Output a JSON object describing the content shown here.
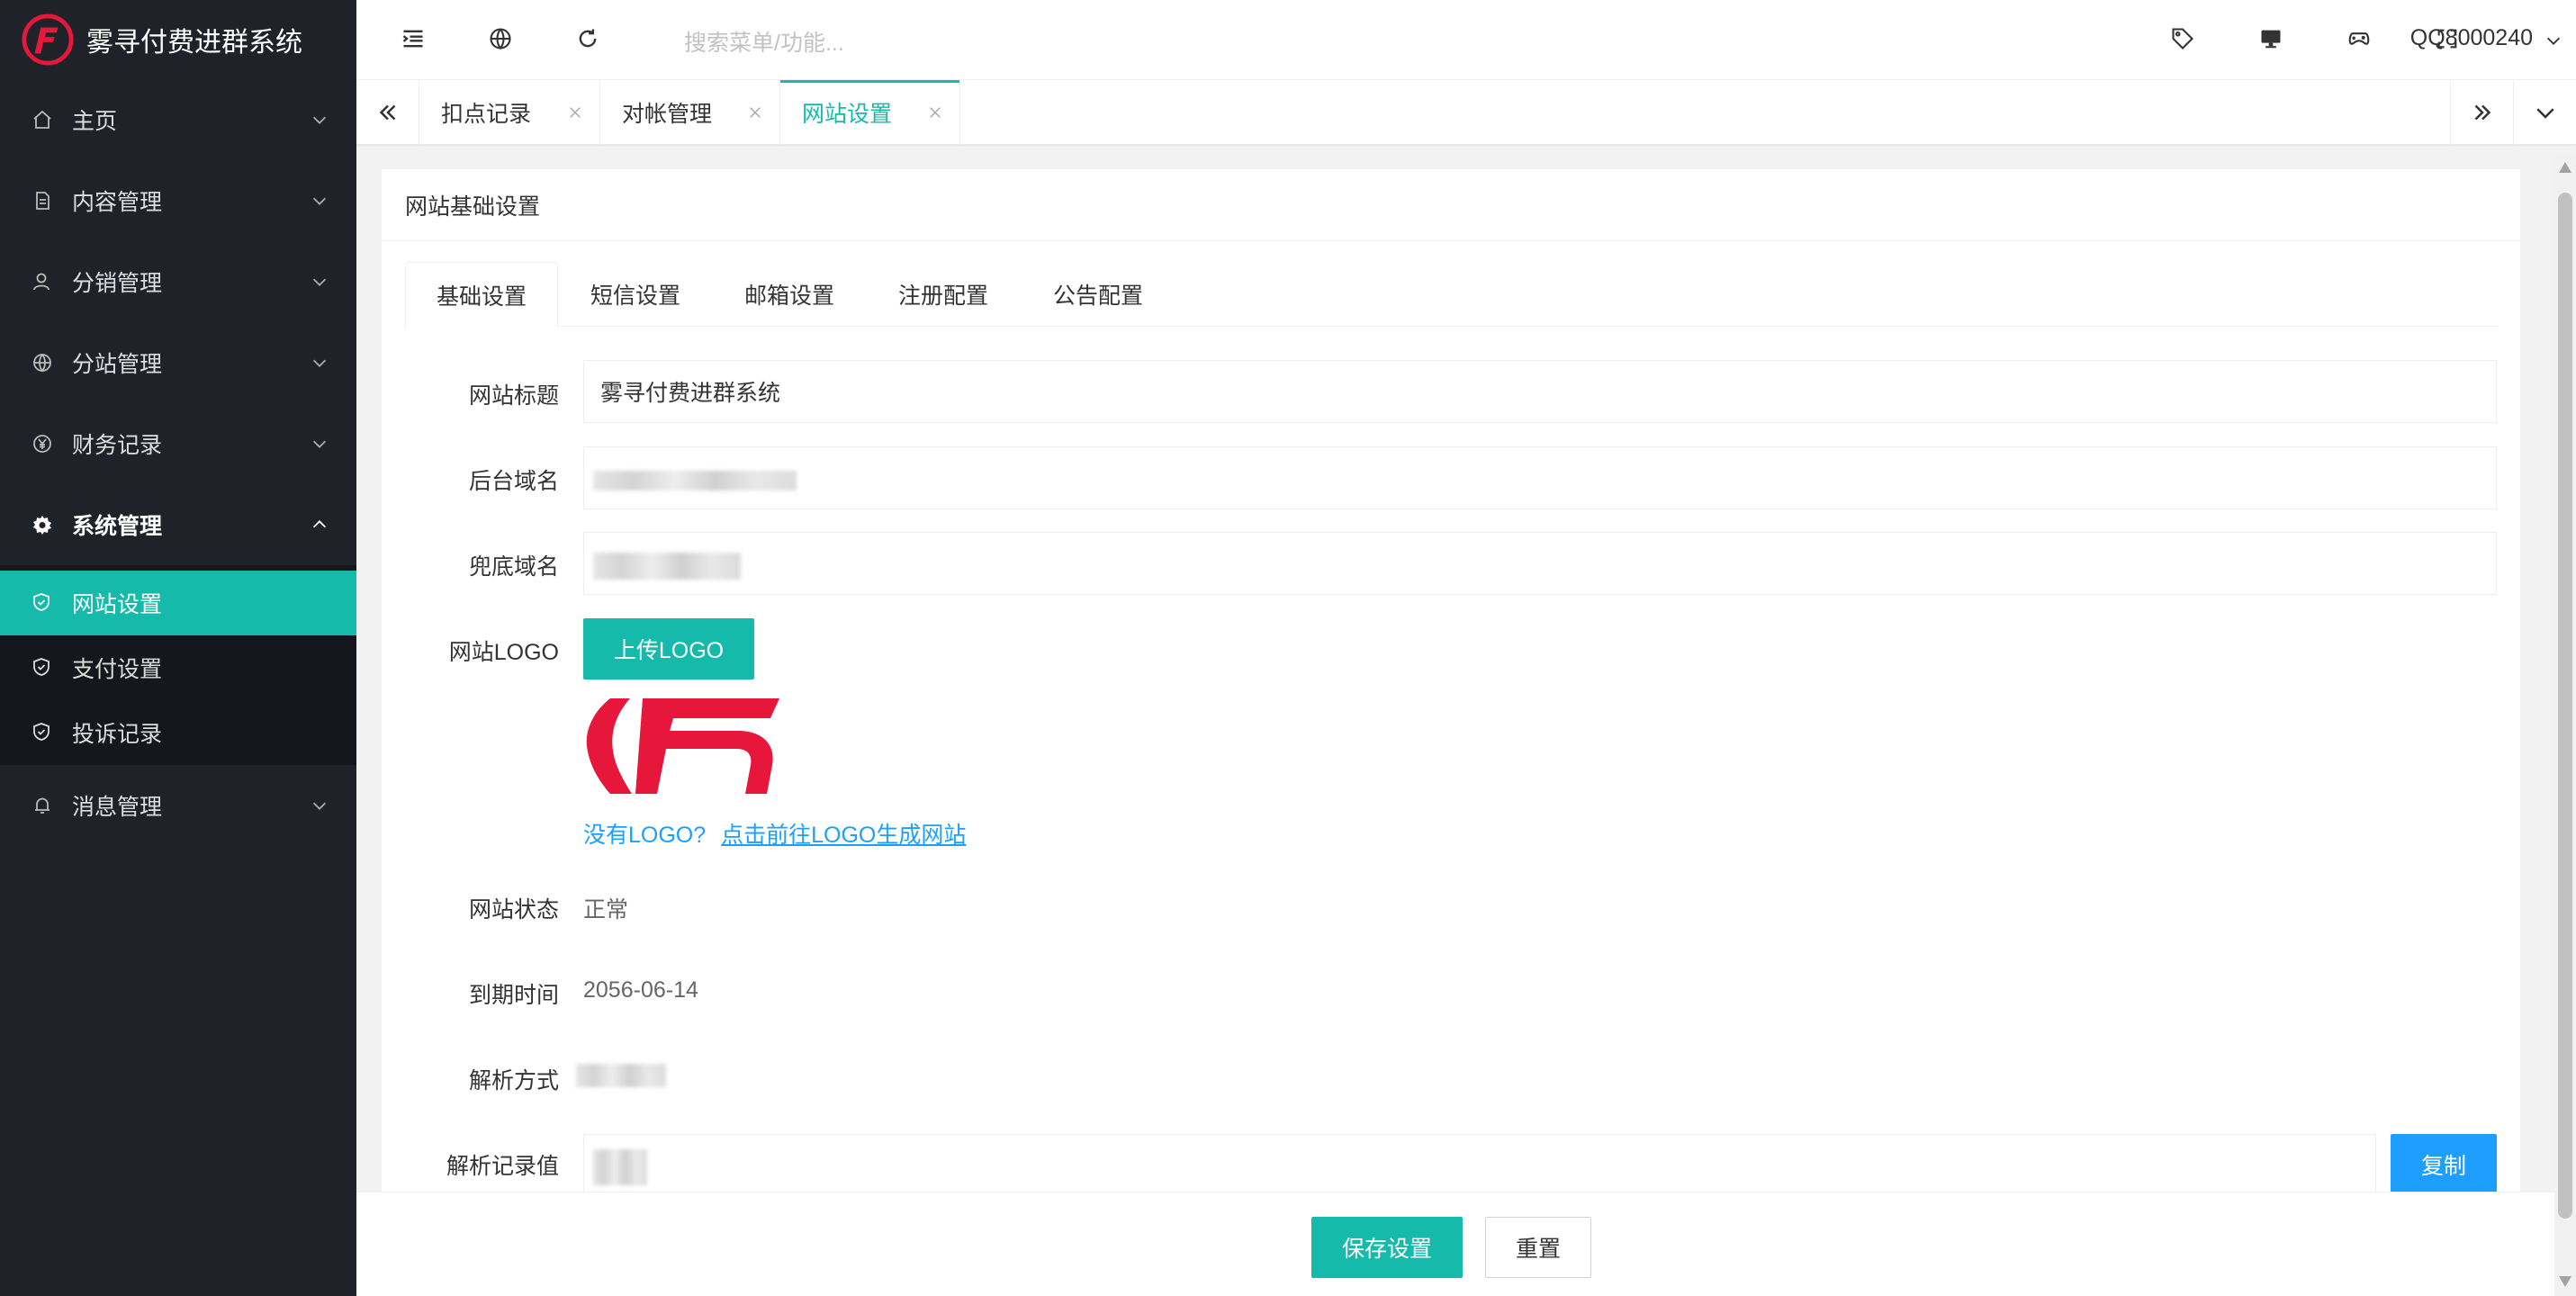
{
  "app": {
    "title": "雾寻付费进群系统",
    "accent": "#16baaa",
    "link_color": "#1e9fff",
    "brand_red": "#e6173a"
  },
  "sidebar": {
    "items": [
      {
        "label": "主页",
        "icon": "home-icon"
      },
      {
        "label": "内容管理",
        "icon": "document-icon"
      },
      {
        "label": "分销管理",
        "icon": "user-icon"
      },
      {
        "label": "分站管理",
        "icon": "globe-icon"
      },
      {
        "label": "财务记录",
        "icon": "yen-icon"
      },
      {
        "label": "系统管理",
        "icon": "gear-icon"
      },
      {
        "label": "消息管理",
        "icon": "bell-icon"
      }
    ],
    "submenu": [
      {
        "label": "网站设置",
        "icon": "shield-check-icon"
      },
      {
        "label": "支付设置",
        "icon": "shield-check-icon"
      },
      {
        "label": "投诉记录",
        "icon": "shield-check-icon"
      }
    ]
  },
  "header": {
    "search_placeholder": "搜索菜单/功能...",
    "user": "QQ8000240"
  },
  "tabs": [
    {
      "label": "扣点记录"
    },
    {
      "label": "对帐管理"
    },
    {
      "label": "网站设置"
    }
  ],
  "card": {
    "title": "网站基础设置",
    "form_tabs": [
      "基础设置",
      "短信设置",
      "邮箱设置",
      "注册配置",
      "公告配置"
    ]
  },
  "form": {
    "site_title_label": "网站标题",
    "site_title_value": "雾寻付费进群系统",
    "admin_domain_label": "后台域名",
    "fallback_domain_label": "兜底域名",
    "logo_label": "网站LOGO",
    "upload_logo": "上传LOGO",
    "no_logo_text": "没有LOGO?",
    "logo_link_text": "点击前往LOGO生成网站",
    "status_label": "网站状态",
    "status_value": "正常",
    "expire_label": "到期时间",
    "expire_value": "2056-06-14",
    "parse_mode_label": "解析方式",
    "parse_value_label": "解析记录值",
    "copy_button": "复制"
  },
  "footer": {
    "save": "保存设置",
    "reset": "重置"
  }
}
